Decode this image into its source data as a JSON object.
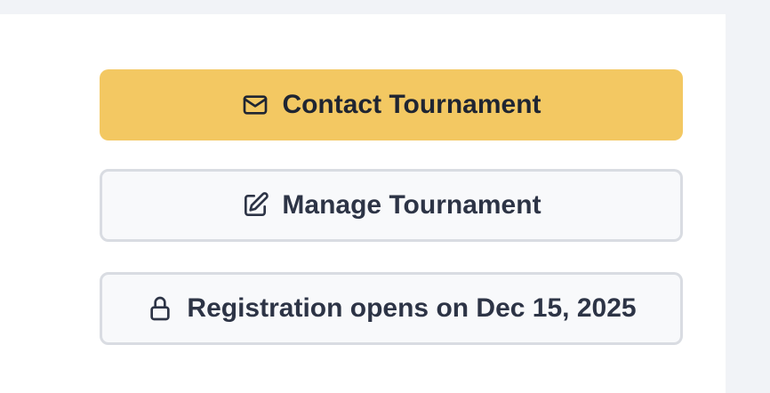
{
  "actions": {
    "contact": {
      "label": "Contact Tournament",
      "icon": "mail-icon",
      "color": "#f3c862"
    },
    "manage": {
      "label": "Manage Tournament",
      "icon": "edit-icon"
    },
    "registration": {
      "label": "Registration opens on Dec 15, 2025",
      "icon": "lock-icon"
    }
  }
}
